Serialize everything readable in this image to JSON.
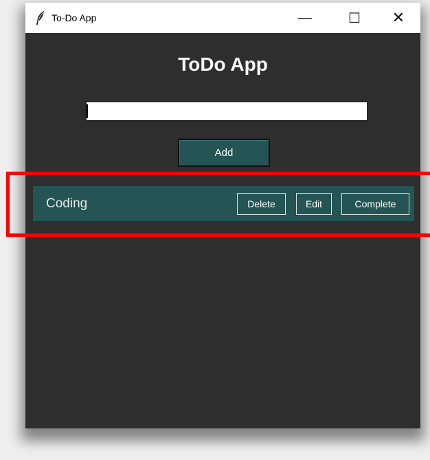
{
  "window": {
    "title": "To-Do App",
    "icon": "feather-icon",
    "controls": {
      "minimize": "—",
      "maximize": "☐",
      "close": "✕"
    }
  },
  "app": {
    "heading": "ToDo App",
    "input": {
      "value": "",
      "placeholder": ""
    },
    "add_label": "Add"
  },
  "tasks": [
    {
      "label": "Coding",
      "actions": {
        "delete": "Delete",
        "edit": "Edit",
        "complete": "Complete"
      }
    }
  ],
  "colors": {
    "window_bg": "#2e2e2e",
    "accent": "#245454",
    "highlight": "#ff0000"
  }
}
